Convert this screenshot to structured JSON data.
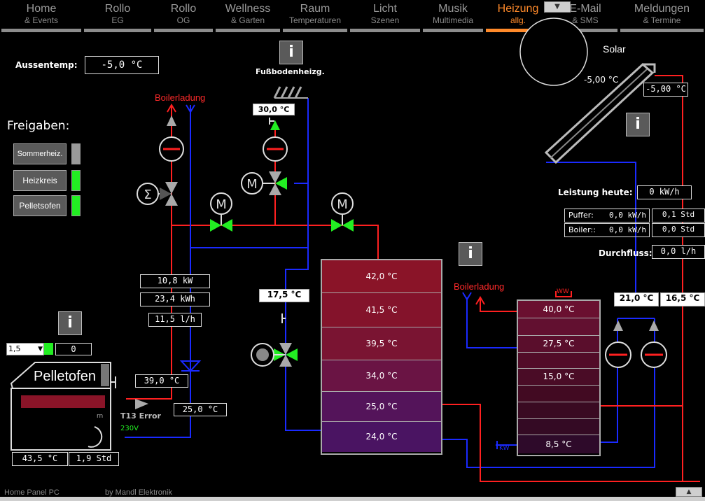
{
  "nav": {
    "tabs": [
      {
        "title": "Home",
        "sub": "&  Events",
        "active": false
      },
      {
        "title": "Rollo",
        "sub": "EG",
        "active": false
      },
      {
        "title": "Rollo",
        "sub": "OG",
        "active": false
      },
      {
        "title": "Wellness",
        "sub": "&  Garten",
        "active": false
      },
      {
        "title": "Raum",
        "sub": "Temperaturen",
        "active": false
      },
      {
        "title": "Licht",
        "sub": "Szenen",
        "active": false
      },
      {
        "title": "Musik",
        "sub": "Multimedia",
        "active": false
      },
      {
        "title": "Heizung",
        "sub": "allg.",
        "active": true
      },
      {
        "title": "E-Mail",
        "sub": "&  SMS",
        "active": false
      },
      {
        "title": "Meldungen",
        "sub": "&  Termine",
        "active": false
      }
    ],
    "dropdown_icon": "chevron-down-icon"
  },
  "outside": {
    "label": "Aussentemp:",
    "value": "-5,0 °C"
  },
  "freigaben": {
    "title": "Freigaben:",
    "items": [
      {
        "label": "Sommerheiz.",
        "state": "off",
        "color": "#9a9a9a"
      },
      {
        "label": "Heizkreis",
        "state": "on",
        "color": "#22ee22"
      },
      {
        "label": "Pelletsofen",
        "state": "on",
        "color": "#22ee22"
      }
    ]
  },
  "floor": {
    "label": "Fußbodenheizg.",
    "temp": "30,0 °C"
  },
  "boilerladung_top": "Boilerladung",
  "boilerladung_mid": "Boilerladung",
  "circuit": {
    "power": "10,8 kW",
    "energy": "23,4 kWh",
    "flow": "11,5 l/h",
    "mix_temp": "17,5 °C"
  },
  "pellet": {
    "title": "Pelletofen",
    "speed": "1,5",
    "count": "0",
    "status_indicator": "#22ee22",
    "temp_out": "39,0 °C",
    "temp_return": "25,0 °C",
    "temp_main": "43,5 °C",
    "hours": "1,9 Std",
    "error": "T13 Error",
    "volt": "230V",
    "symbol": "rn"
  },
  "puffer": {
    "cells": [
      {
        "temp": "42,0 °C",
        "color": "#8a1428"
      },
      {
        "temp": "41,5 °C",
        "color": "#84132b"
      },
      {
        "temp": "39,5 °C",
        "color": "#7a1432"
      },
      {
        "temp": "34,0 °C",
        "color": "#6a1444"
      },
      {
        "temp": "25,0 °C",
        "color": "#54145a"
      },
      {
        "temp": "24,0 °C",
        "color": "#4a1462"
      }
    ]
  },
  "boiler": {
    "ww_label": "WW",
    "kw_label": "KW",
    "cells": [
      {
        "temp": "40,0 °C"
      },
      {
        "temp": ""
      },
      {
        "temp": "27,5 °C"
      },
      {
        "temp": ""
      },
      {
        "temp": "15,0 °C"
      },
      {
        "temp": ""
      },
      {
        "temp": ""
      },
      {
        "temp": ""
      },
      {
        "temp": "8,5 °C"
      }
    ]
  },
  "solar": {
    "label": "Solar",
    "panel_temp": "-5,00 °C",
    "box_temp": "-5,00 °C",
    "leistung_label": "Leistung heute:",
    "leistung_value": "0 kW/h",
    "puffer_label": "Puffer:",
    "puffer_kw": "0,0 kW/h",
    "puffer_std": "0,1 Std",
    "boiler_label": "Boiler::",
    "boiler_kw": "0,0 kW/h",
    "boiler_std": "0,0 Std",
    "durchfluss_label": "Durchfluss:",
    "durchfluss_value": "0,0 l/h",
    "t1": "21,0 °C",
    "t2": "16,5 °C"
  },
  "footer": {
    "left": "Home Panel PC",
    "right": "by Mandl Elektronik"
  },
  "colors": {
    "red": "#ff2020",
    "blue": "#1a2aff",
    "green": "#22ee22",
    "orange": "#ff8a2a"
  }
}
